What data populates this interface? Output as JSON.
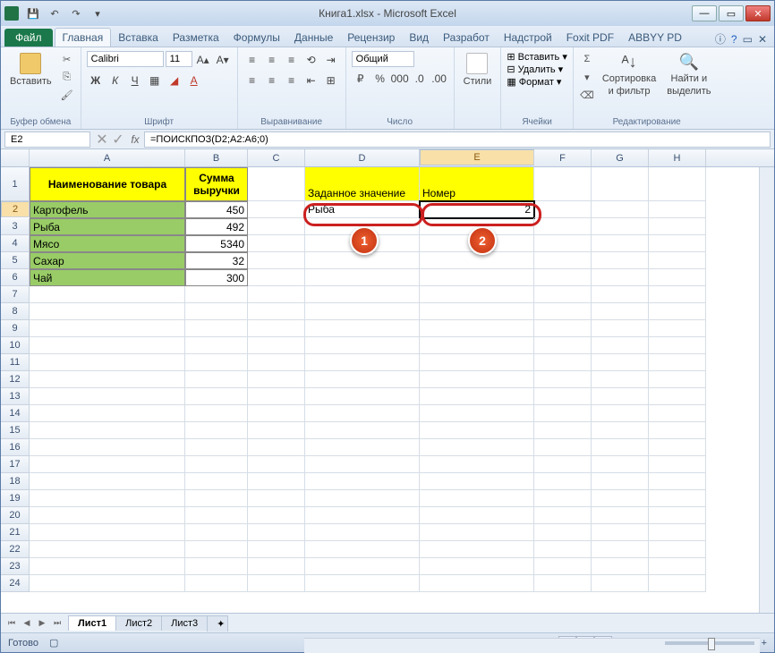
{
  "title": "Книга1.xlsx - Microsoft Excel",
  "tabs": {
    "file": "Файл",
    "home": "Главная",
    "insert": "Вставка",
    "layout": "Разметка",
    "formulas": "Формулы",
    "data": "Данные",
    "review": "Рецензир",
    "view": "Вид",
    "developer": "Разработ",
    "addins": "Надстрой",
    "foxit": "Foxit PDF",
    "abbyy": "ABBYY PD"
  },
  "groups": {
    "clipboard": "Буфер обмена",
    "font": "Шрифт",
    "alignment": "Выравнивание",
    "number": "Число",
    "styles": "Стили",
    "cells": "Ячейки",
    "editing": "Редактирование"
  },
  "ribbon": {
    "paste": "Вставить",
    "font_name": "Calibri",
    "font_size": "11",
    "number_format": "Общий",
    "insert_cells": "Вставить",
    "delete_cells": "Удалить",
    "format_cells": "Формат",
    "sort": "Сортировка",
    "filter": "и фильтр",
    "find": "Найти и",
    "select": "выделить"
  },
  "name_box": "E2",
  "formula": "=ПОИСКПОЗ(D2;A2:A6;0)",
  "columns": [
    "A",
    "B",
    "C",
    "D",
    "E",
    "F",
    "G",
    "H"
  ],
  "headers": {
    "a1": "Наименование товара",
    "b1_line1": "Сумма",
    "b1_line2": "выручки",
    "d1": "Заданное значение",
    "e1": "Номер"
  },
  "data": {
    "rows": [
      {
        "name": "Картофель",
        "val": "450"
      },
      {
        "name": "Рыба",
        "val": "492"
      },
      {
        "name": "Мясо",
        "val": "5340"
      },
      {
        "name": "Сахар",
        "val": "32"
      },
      {
        "name": "Чай",
        "val": "300"
      }
    ],
    "d2": "Рыба",
    "e2": "2"
  },
  "annotations": {
    "a1": "1",
    "a2": "2"
  },
  "sheets": {
    "s1": "Лист1",
    "s2": "Лист2",
    "s3": "Лист3"
  },
  "status": "Готово",
  "zoom": "100%"
}
